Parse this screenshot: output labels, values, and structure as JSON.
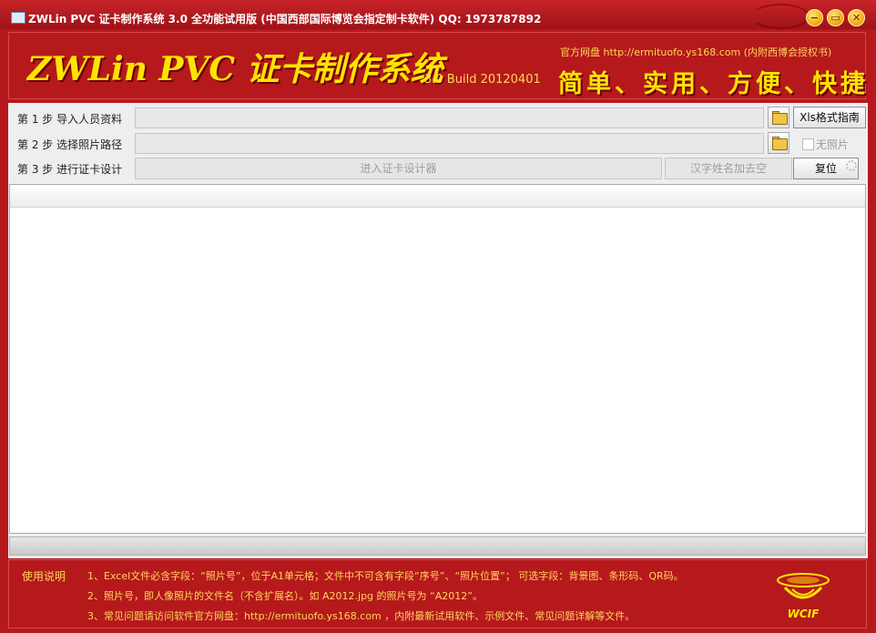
{
  "window": {
    "title": "ZWLin PVC 证卡制作系统 3.0 全功能试用版 (中国西部国际博览会指定制卡软件) QQ: 1973787892",
    "icon": "id-card-app-icon",
    "controls": {
      "minimize": "−",
      "restore": "▭",
      "close": "✕"
    }
  },
  "banner": {
    "logo": "ZWLin PVC 证卡制作系统",
    "build": "3.0 Build 20120401",
    "site_label": "官方网盘 http://ermituofo.ys168.com (内附西博会授权书)",
    "slogan": "简单、实用、方便、快捷"
  },
  "steps": {
    "step1": {
      "label": "第 1 步  导入人员资料",
      "value": "",
      "action": "Xls格式指南"
    },
    "step2": {
      "label": "第 2 步  选择照片路径",
      "value": "",
      "checkbox_label": "无照片",
      "checked": false
    },
    "step3": {
      "label": "第 3 步  进行证卡设计",
      "design_button": "进入证卡设计器",
      "space_button": "汉字姓名加去空",
      "reset_button": "复位"
    }
  },
  "footer": {
    "title": "使用说明",
    "lines": [
      "1、Excel文件必含字段：“照片号”，位于A1单元格；文件中不可含有字段“序号”、“照片位置”；  可选字段：背景图、条形码、QR码。",
      "2、照片号，即人像照片的文件名（不含扩展名）。如 A2012.jpg 的照片号为 “A2012”。",
      "3、常见问题请访问软件官方网盘：http://ermituofo.ys168.com ，内附最新试用软件、示例文件、常见问题详解等文件。"
    ],
    "emblem_text": "WCIF"
  },
  "colors": {
    "brand_red": "#b5191c",
    "gold_text": "#ffd65a",
    "logo_yellow": "#ffe400"
  }
}
